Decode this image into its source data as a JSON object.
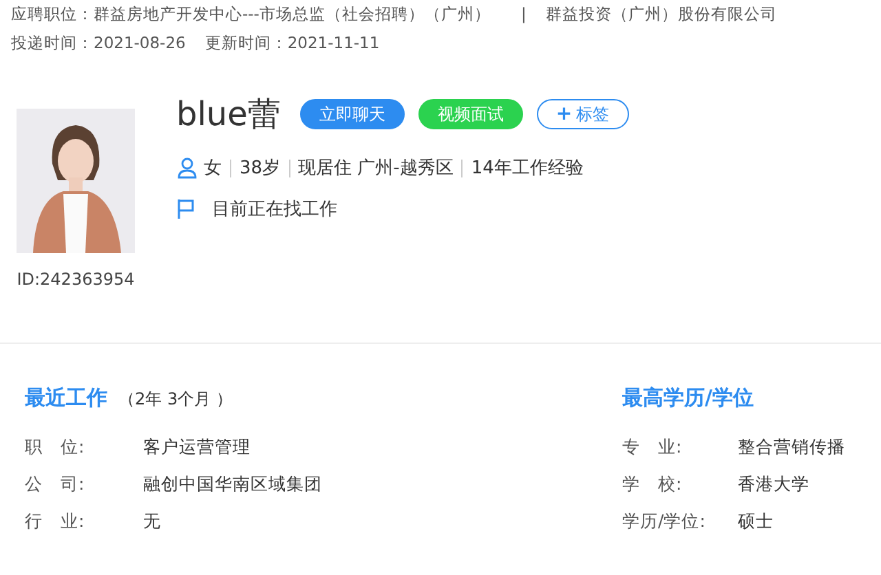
{
  "header": {
    "position_label": "应聘职位：",
    "position": "群益房地产开发中心---市场总监（社会招聘）（广州）",
    "separator": "|",
    "company": "群益投资（广州）股份有限公司",
    "delivered_label": "投递时间：",
    "delivered": "2021-08-26",
    "updated_label": "更新时间：",
    "updated": "2021-11-11"
  },
  "profile": {
    "id": "ID:242363954",
    "name": "blue蕾",
    "buttons": [
      {
        "kind": "chat",
        "label": "立即聊天"
      },
      {
        "kind": "video",
        "label": "视频面试"
      },
      {
        "kind": "tag",
        "icon": "+",
        "label": "标签"
      }
    ],
    "facts": [
      "女",
      "38岁",
      "现居住 广州-越秀区",
      "14年工作经验"
    ],
    "status": "目前正在找工作"
  },
  "recent_work": {
    "title": "最近工作",
    "duration": "（2年 3个月 ）",
    "rows": [
      {
        "label": "职　位:",
        "value": "客户运营管理"
      },
      {
        "label": "公　司:",
        "value": "融创中国华南区域集团"
      },
      {
        "label": "行　业:",
        "value": "无"
      }
    ]
  },
  "education": {
    "title": "最高学历/学位",
    "rows": [
      {
        "label": "专　业:",
        "value": "整合营销传播"
      },
      {
        "label": "学　校:",
        "value": "香港大学"
      },
      {
        "label": "学历/学位:",
        "value": "硕士"
      }
    ]
  }
}
